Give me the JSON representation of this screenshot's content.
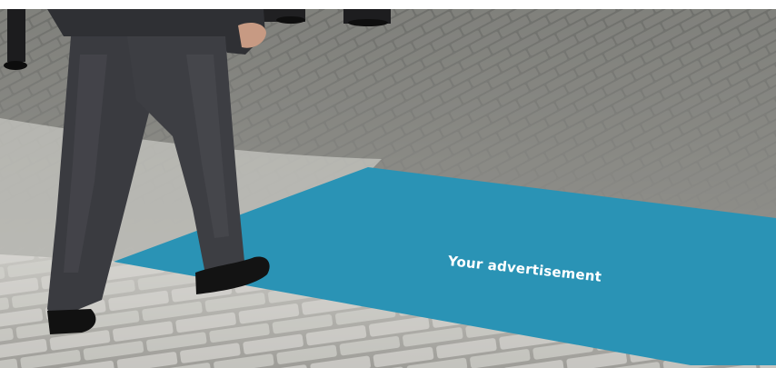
{
  "advertisement": {
    "text": "Your advertisement",
    "color": "#2a93b5"
  },
  "scene": {
    "background_color": "#ffffff",
    "pavement_color": "#7f7f7b",
    "foreground_pavement_color": "#c8c7c2",
    "suit_color": "#3c3d42",
    "shoe_color": "#121212"
  }
}
